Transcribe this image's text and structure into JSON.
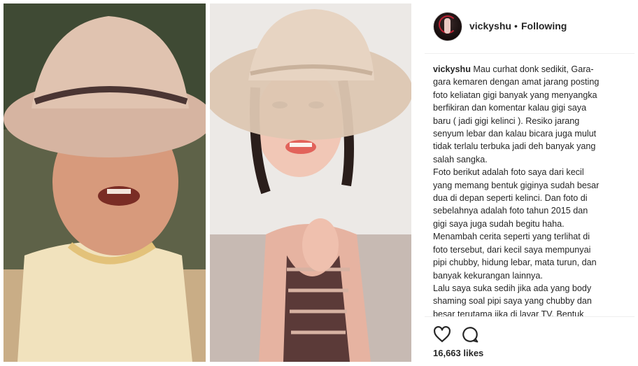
{
  "post": {
    "username": "vickyshu",
    "separator": "•",
    "follow_status": "Following",
    "caption_username": "vickyshu",
    "caption_text": "Mau curhat donk sedikit, Gara-\ngara kemaren dengan amat jarang posting\nfoto keliatan gigi banyak yang menyangka\nberfikiran dan komentar kalau gigi saya\nbaru ( jadi gigi kelinci ). Resiko jarang\nsenyum lebar dan kalau bicara juga mulut\ntidak terlalu terbuka jadi deh banyak yang\nsalah sangka.\nFoto berikut adalah foto saya dari kecil\nyang memang bentuk giginya sudah besar\ndua di depan seperti kelinci. Dan foto di\nsebelahnya adalah foto tahun 2015 dan\ngigi saya juga sudah begitu haha.\nMenambah cerita seperti yang terlihat di\nfoto tersebut, dari kecil saya mempunyai\npipi chubby, hidung lebar, mata turun, dan\nbanyak kekurangan lainnya.\nLalu saya suka sedih jika ada yang body\nshaming soal pipi saya yang chubby dan\nbesar terutama jika di layar TV. Bentuk",
    "likes": "16,663 likes"
  },
  "icons": {
    "like": "heart-icon",
    "comment": "comment-icon"
  }
}
